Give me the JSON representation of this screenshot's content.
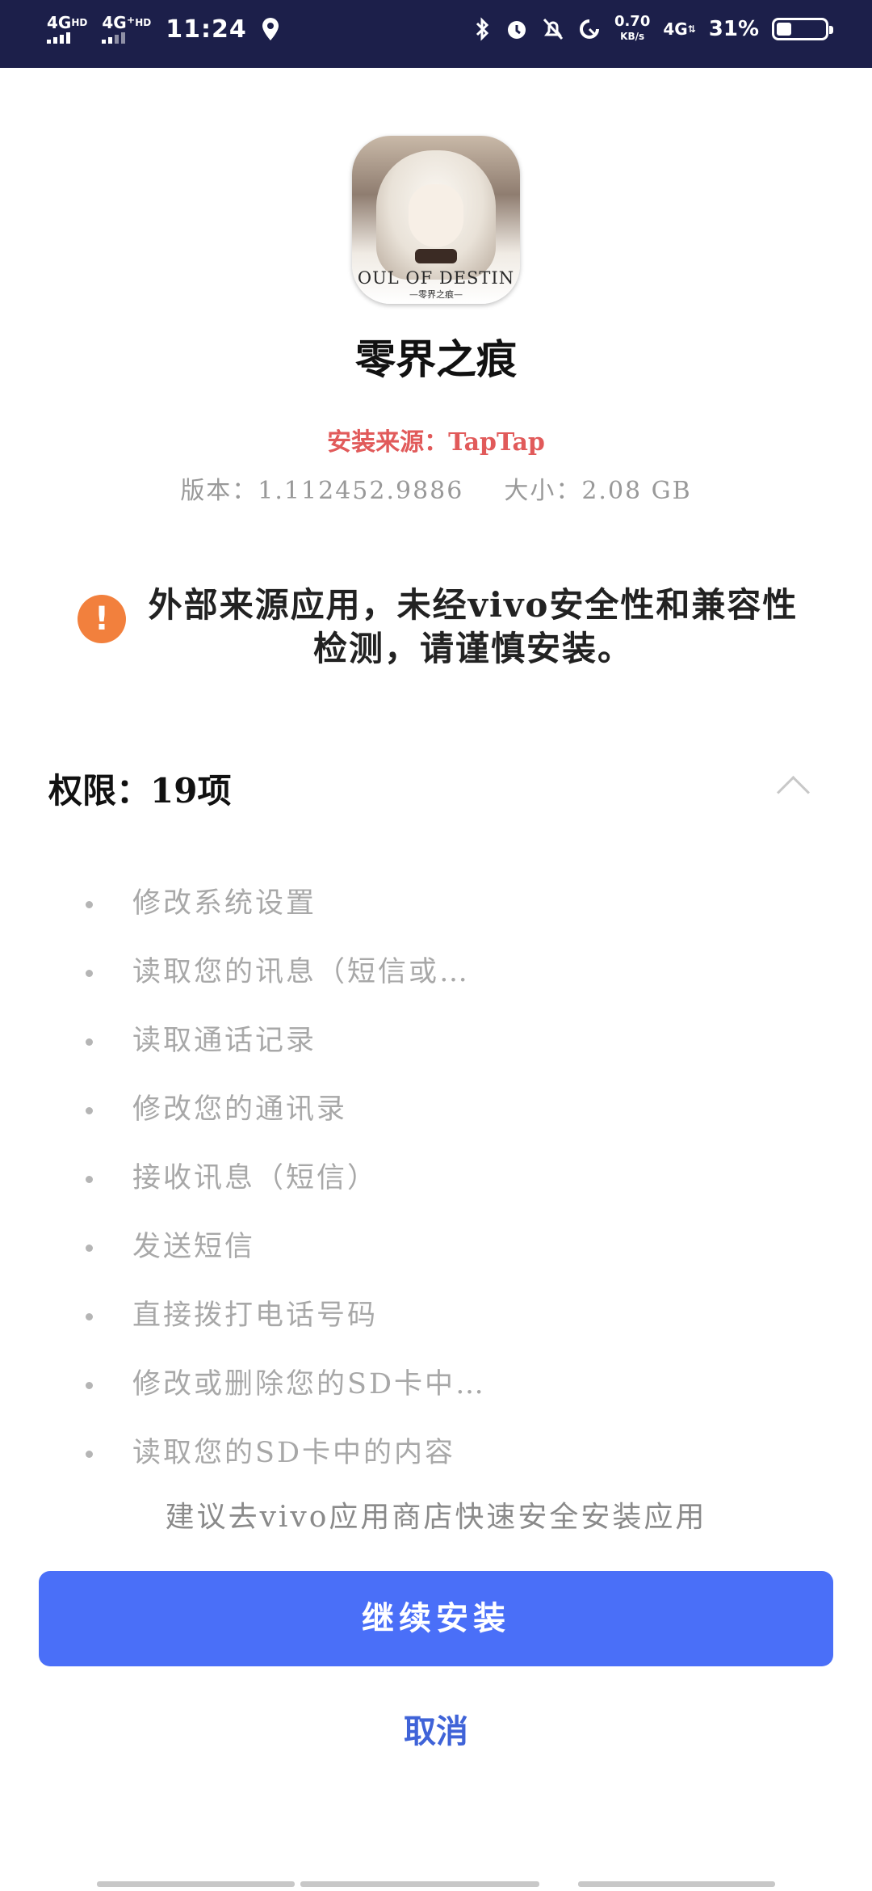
{
  "status_bar": {
    "network1": "4G",
    "network1_sup": "HD",
    "network2": "4G⁺",
    "network2_sup": "HD",
    "time": "11:24",
    "speed_value": "0.70",
    "speed_unit": "KB/s",
    "network3": "4G",
    "network3_sup": "⇅",
    "battery_percent": "31%",
    "battery_level": 0.31
  },
  "app": {
    "icon_logo_text": "OUL OF DESTIN",
    "icon_logo_sub": "—零界之痕—",
    "name": "零界之痕",
    "source": "安装来源：TapTap",
    "version": "版本：1.112452.9886",
    "size": "大小：2.08 GB"
  },
  "warning": {
    "icon": "!",
    "text": "外部来源应用，未经vivo安全性和兼容性检测，请谨慎安装。"
  },
  "permissions": {
    "title": "权限：19项",
    "items": [
      "修改系统设置",
      "读取您的讯息（短信或…",
      "读取通话记录",
      "修改您的通讯录",
      "接收讯息（短信）",
      "发送短信",
      "直接拨打电话号码",
      "修改或删除您的SD卡中…",
      "读取您的SD卡中的内容"
    ]
  },
  "store_tip": "建议去vivo应用商店快速安全安装应用",
  "buttons": {
    "continue": "继续安装",
    "cancel": "取消"
  },
  "colors": {
    "status_bar": "#1c1f4a",
    "source_red": "#e15a5a",
    "warning_orange": "#f2803d",
    "primary_blue": "#4a6ff8",
    "cancel_blue": "#3f63d8"
  }
}
